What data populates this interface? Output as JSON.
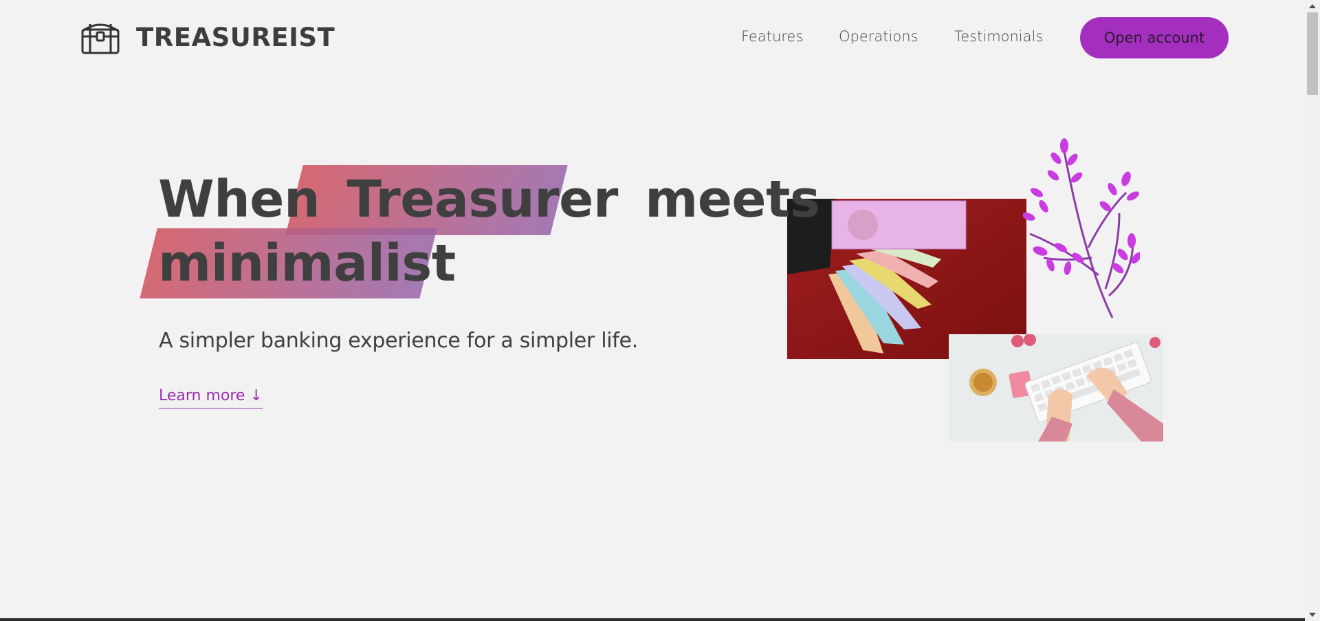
{
  "brand": {
    "name": "TREASUREIST",
    "logo_icon": "treasure-chest-icon"
  },
  "nav": {
    "features": "Features",
    "operations": "Operations",
    "testimonials": "Testimonials",
    "cta": "Open account"
  },
  "hero": {
    "title_words": [
      "When",
      "Treasurer",
      "meets",
      "minimalist"
    ],
    "subtitle": "A simpler banking experience for a simpler life.",
    "learn_more": "Learn more ↓"
  },
  "images": {
    "money": "indian-currency-notes-image",
    "keyboard": "typing-on-keyboard-image",
    "plant": "purple-plant-illustration"
  },
  "colors": {
    "accent": "#a42fbf",
    "link": "#9b2fb0",
    "highlight_start": "#d25a64",
    "highlight_end": "#9664aa",
    "background": "#f3f2f3",
    "text": "#3f3f3f"
  }
}
